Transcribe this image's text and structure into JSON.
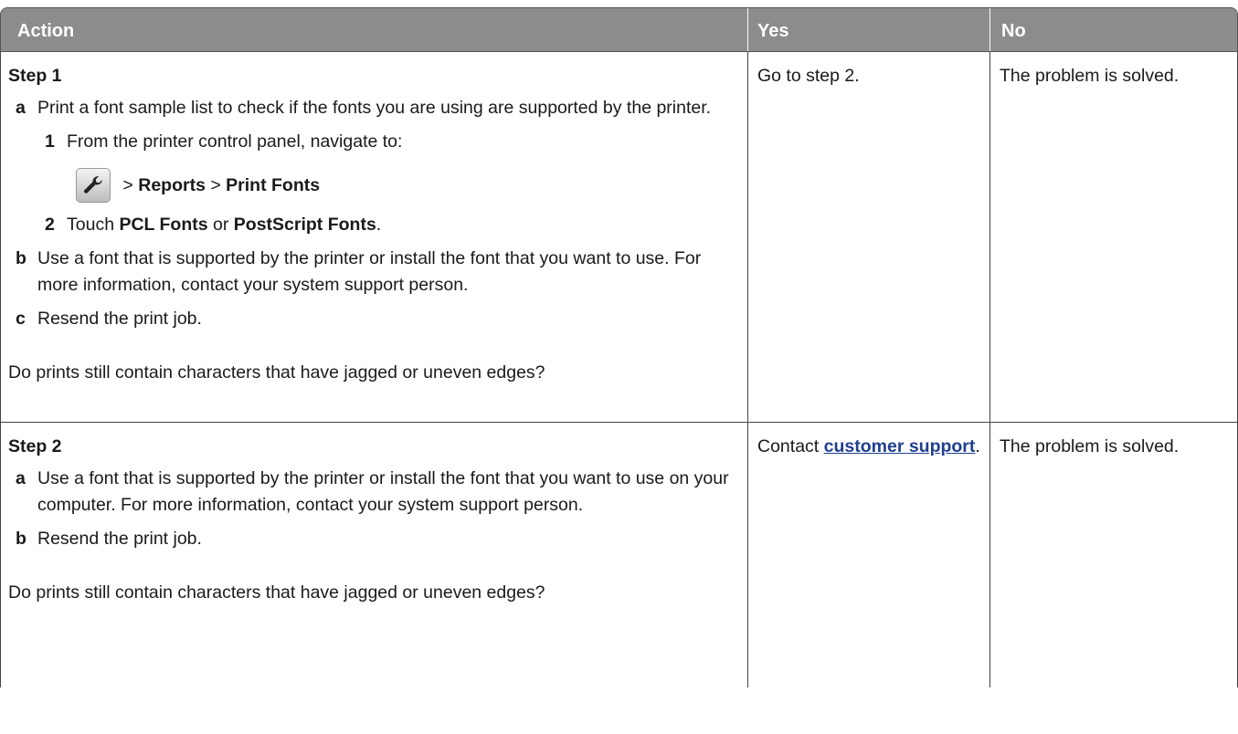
{
  "header": {
    "action": "Action",
    "yes": "Yes",
    "no": "No"
  },
  "step1": {
    "title": "Step 1",
    "a_letter": "a",
    "a_text": "Print a font sample list to check if the fonts you are using are supported by the printer.",
    "sub1_num": "1",
    "sub1_text": "From the printer control panel, navigate to:",
    "path_sep1": " > ",
    "path_reports": "Reports",
    "path_sep2": " > ",
    "path_print_fonts": "Print Fonts",
    "sub2_num": "2",
    "sub2_pre": "Touch ",
    "sub2_pcl": "PCL Fonts",
    "sub2_or": " or ",
    "sub2_ps": "PostScript Fonts",
    "sub2_end": ".",
    "b_letter": "b",
    "b_text": "Use a font that is supported by the printer or install the font that you want to use. For more information, contact your system support person.",
    "c_letter": "c",
    "c_text": "Resend the print job.",
    "question": "Do prints still contain characters that have jagged or uneven edges?",
    "yes": "Go to step 2.",
    "no": "The problem is solved."
  },
  "step2": {
    "title": "Step 2",
    "a_letter": "a",
    "a_text": "Use a font that is supported by the printer or install the font that you want to use on your computer. For more information, contact your system support person.",
    "b_letter": "b",
    "b_text": "Resend the print job.",
    "question": "Do prints still contain characters that have jagged or uneven edges?",
    "yes_pre": "Contact ",
    "yes_link": "customer support",
    "yes_end": ".",
    "no": "The problem is solved."
  },
  "icons": {
    "settings": "wrench-icon"
  }
}
